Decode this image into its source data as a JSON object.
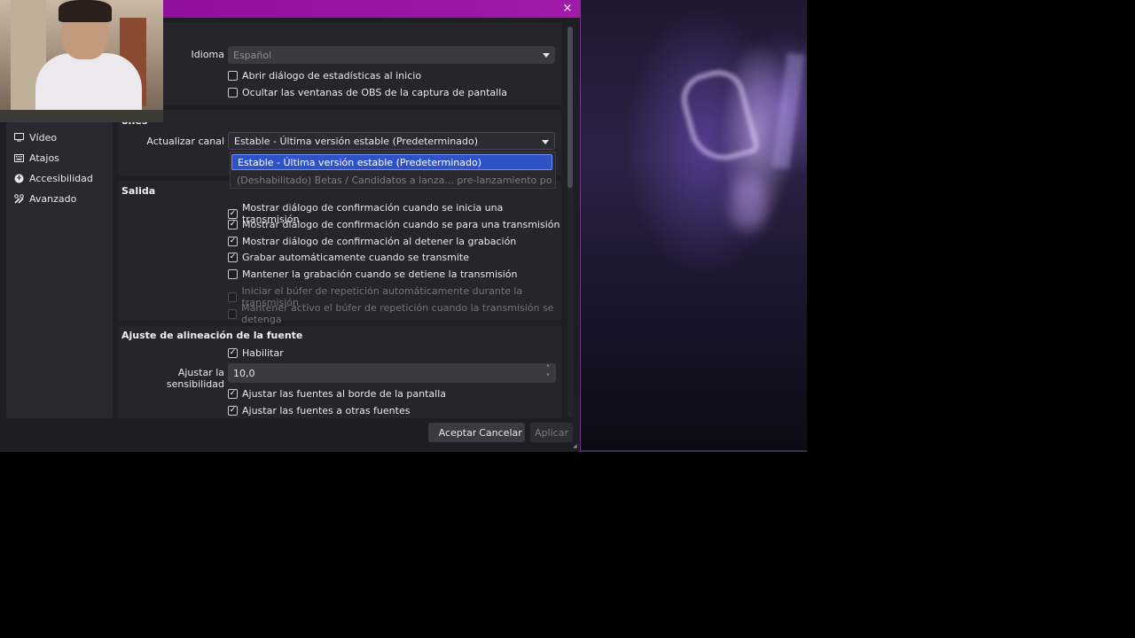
{
  "dialog": {
    "close_glyph": "×"
  },
  "sidebar": {
    "items": [
      {
        "label": "Vídeo",
        "icon": "monitor-icon"
      },
      {
        "label": "Atajos",
        "icon": "keyboard-icon"
      },
      {
        "label": "Accesibilidad",
        "icon": "accessibility-icon"
      },
      {
        "label": "Avanzado",
        "icon": "tools-icon"
      }
    ]
  },
  "general": {
    "language_label": "Idioma",
    "language_value": "Español",
    "checks": [
      {
        "label": "Abrir diálogo de estadísticas al inicio",
        "checked": false
      },
      {
        "label": "Ocultar las ventanas de OBS de la captura de pantalla",
        "checked": false
      }
    ]
  },
  "updates": {
    "title_fragment": "ones",
    "channel_label": "Actualizar canal",
    "channel_value": "Estable - Última versión estable (Predeterminado)",
    "dropdown_options": [
      "Estable - Última versión estable (Predeterminado)",
      "(Deshabilitado) Betas / Candidatos a lanza... pre-lanzamiento potencialmente inestables"
    ]
  },
  "output": {
    "title": "Salida",
    "checks": [
      {
        "label": "Mostrar diálogo de confirmación cuando se inicia una transmisión",
        "checked": true,
        "enabled": true
      },
      {
        "label": "Mostrar diálogo de confirmación cuando se para una transmisión",
        "checked": true,
        "enabled": true
      },
      {
        "label": "Mostrar diálogo de confirmación al detener la grabación",
        "checked": true,
        "enabled": true
      },
      {
        "label": "Grabar automáticamente cuando se transmite",
        "checked": true,
        "enabled": true
      },
      {
        "label": "Mantener la grabación cuando se detiene la transmisión",
        "checked": false,
        "enabled": true
      },
      {
        "label": "Iniciar el búfer de repetición automáticamente durante la transmisión",
        "checked": false,
        "enabled": false
      },
      {
        "label": "Mantener activo el búfer de repetición cuando la transmisión se detenga",
        "checked": false,
        "enabled": false
      }
    ]
  },
  "snapping": {
    "title": "Ajuste de alineación de la fuente",
    "enable_label": "Habilitar",
    "sensitivity_label": "Ajustar la sensibilidad",
    "sensitivity_value": "10,0",
    "checks": [
      {
        "label": "Ajustar las fuentes al borde de la pantalla",
        "checked": true
      },
      {
        "label": "Ajustar las fuentes a otras fuentes",
        "checked": true
      }
    ]
  },
  "footer": {
    "ok": "Aceptar",
    "cancel": "Cancelar",
    "apply": "Aplicar"
  },
  "colors": {
    "titlebar": "#a11aa8",
    "selection": "#2f53c7"
  }
}
